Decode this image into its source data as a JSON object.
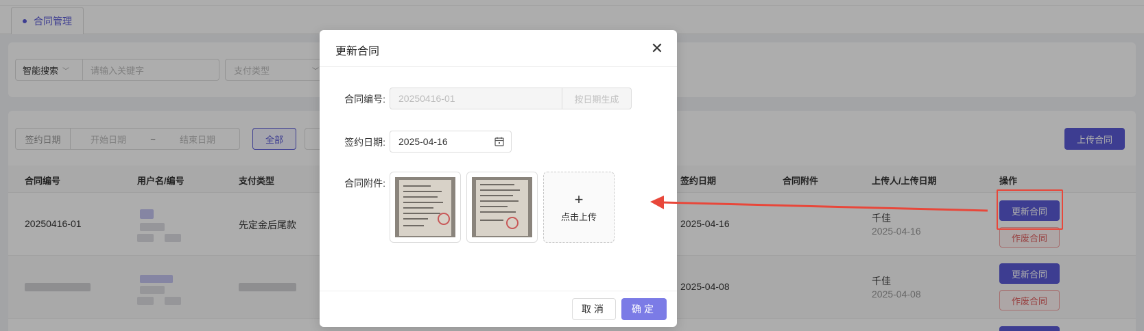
{
  "tabs": [
    {
      "label": "合同管理",
      "active": true
    }
  ],
  "search": {
    "mode_label": "智能搜索",
    "keyword_placeholder": "请输入关键字",
    "pay_type_placeholder": "支付类型"
  },
  "filter": {
    "date_label": "签约日期",
    "start_placeholder": "开始日期",
    "separator": "~",
    "end_placeholder": "结束日期",
    "all_button": "全部",
    "upload_button": "上传合同"
  },
  "table": {
    "columns": [
      "合同编号",
      "用户名/编号",
      "支付类型",
      "签约日期",
      "合同附件",
      "上传人/上传日期",
      "操作"
    ],
    "rows": [
      {
        "contract_no": "20250416-01",
        "pay_type": "先定金后尾款",
        "sign_date": "2025-04-16",
        "uploader": "千佳",
        "upload_date": "2025-04-16"
      },
      {
        "contract_no": "",
        "pay_type": "",
        "sign_date": "2025-04-08",
        "uploader": "千佳",
        "upload_date": "2025-04-08"
      }
    ],
    "update_button": "更新合同",
    "void_button": "作废合同"
  },
  "modal": {
    "title": "更新合同",
    "contract_no_label": "合同编号:",
    "contract_no_value": "20250416-01",
    "generate_button": "按日期生成",
    "sign_date_label": "签约日期:",
    "sign_date_value": "2025-04-16",
    "attachment_label": "合同附件:",
    "upload_text": "点击上传",
    "upload_plus": "+",
    "cancel_button": "取消",
    "ok_button": "确定"
  },
  "colors": {
    "primary": "#5b5bd6",
    "danger": "#e8473a"
  }
}
